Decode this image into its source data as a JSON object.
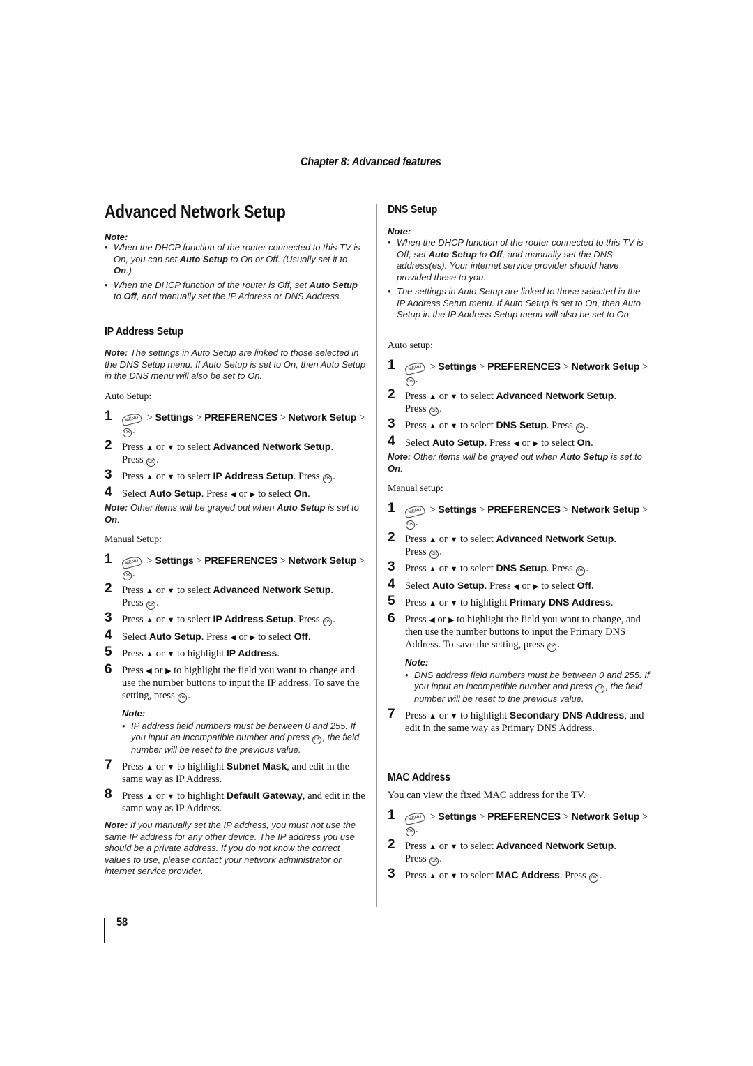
{
  "header": {
    "chapter": "Chapter 8: Advanced features"
  },
  "page_title": "Advanced Network Setup",
  "icons": {
    "menu": "menu-button-icon",
    "ok": "ok-button-icon",
    "up": "▲",
    "down": "▼",
    "left": "◀",
    "right": "▶"
  },
  "intro_note": {
    "label": "Note:",
    "bullets": [
      {
        "a": "When the DHCP function of the router connected to this TV is On, you can set ",
        "b": "Auto Setup",
        "c": " to On or Off. (Usually set it to ",
        "d": "On",
        "e": ".)"
      },
      {
        "a": "When the DHCP function of the router is Off, set ",
        "b": "Auto Setup",
        "c": " to ",
        "d": "Off",
        "e": ", and manually set the IP Address or DNS Address."
      }
    ]
  },
  "ip": {
    "heading": "IP Address Setup",
    "note": {
      "label": "Note:",
      "text": " The settings in Auto Setup are linked to those selected in the DNS Setup menu. If Auto Setup is set to On, then Auto Setup in the DNS menu will also be set to On."
    },
    "auto_label": "Auto Setup:",
    "manual_label": "Manual Setup:",
    "grayed_note": {
      "label": "Note:",
      "a": " Other items will be grayed out when ",
      "b": "Auto Setup",
      "c": " is set to ",
      "d": "On",
      "e": "."
    },
    "field_note": {
      "label": "Note:",
      "a": "IP address field numbers must be between 0 and 255. If you input an incompatible number and press ",
      "b": ", the field number will be reset to the previous value."
    },
    "final_note": {
      "label": "Note:",
      "text": " If you manually set the IP address, you must not use the same IP address for any other device. The IP address you use should be a private address. If you do not know the correct values to use, please contact your network administrator or internet service provider."
    }
  },
  "steps": {
    "n1": "1",
    "n2": "2",
    "n3": "3",
    "n4": "4",
    "n5": "5",
    "n6": "6",
    "n7": "7",
    "n8": "8",
    "sep": " > ",
    "settings": "Settings",
    "prefs": "PREFERENCES",
    "network": "Network",
    "setup": "Setup",
    "dot": ".",
    "press": "Press ",
    "or": " or ",
    "to_select": " to select ",
    "to_highlight": " to highlight ",
    "select": "Select ",
    "adv": "Advanced Network Setup",
    "ipsetup": "IP Address Setup",
    "dnssetup": "DNS Setup",
    "macaddr": "MAC Address",
    "auto": "Auto Setup",
    "on": "On",
    "off": "Off",
    "press_dot": ". Press ",
    "ipaddr": "IP Address",
    "subnet": "Subnet Mask",
    "gateway": "Default Gateway",
    "ip6": " to highlight the field you want to change and use the number buttons to input the IP address. To save the setting, press ",
    "ip7": ", and edit in the same way as IP Address.",
    "ip8": ", and edit in the same way as IP Address.",
    "primary": "Primary DNS Address",
    "dns6": " to highlight the field you want to change, and then use the number buttons to input the Primary DNS Address. To save the setting, press ",
    "secondary": "Secondary DNS Address",
    "dns7": ", and edit in the same way as Primary DNS Address."
  },
  "dns": {
    "heading": "DNS Setup",
    "note_label": "Note:",
    "bullets": [
      {
        "a": "When the DHCP function of the router connected to this TV is Off, set ",
        "b": "Auto Setup",
        "c": " to ",
        "d": "Off",
        "e": ", and manually set the DNS address(es). Your internet service provider should have provided these to you."
      },
      {
        "a": "The settings in Auto Setup are linked to those selected in the IP Address Setup menu. If Auto Setup is set to On, then Auto Setup in the IP Address Setup menu will also be set to On."
      }
    ],
    "auto_label": "Auto setup:",
    "manual_label": "Manual setup:",
    "grayed_note": {
      "label": "Note:",
      "a": " Other items will be grayed out when ",
      "b": "Auto Setup",
      "c": " is set to ",
      "d": "On",
      "e": "."
    },
    "field_note": {
      "label": "Note:",
      "a": "DNS address field numbers must be between 0 and 255. If you input an incompatible number and press ",
      "b": ", the field number will be reset to the previous value."
    }
  },
  "mac": {
    "heading": "MAC Address",
    "intro": "You can view the fixed MAC address for the TV."
  },
  "page_number": "58"
}
